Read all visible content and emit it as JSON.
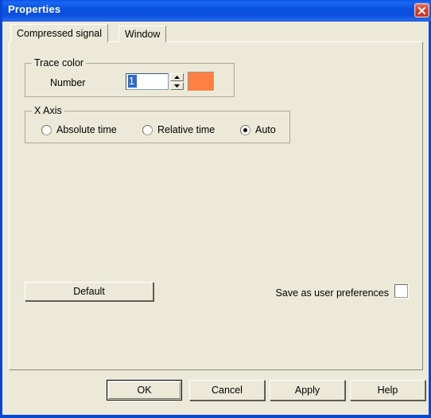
{
  "window": {
    "title": "Properties",
    "close_icon": "close-x-icon",
    "border_color": "#0a46d2",
    "titlebar_color": "#0b4fdc",
    "face_color": "#ece9d8"
  },
  "tabs": [
    {
      "label": "Compressed signal",
      "active": true
    },
    {
      "label": "Window",
      "active": false
    }
  ],
  "trace_color_group": {
    "title": "Trace color",
    "number_label": "Number",
    "number_value": "1",
    "number_placeholder": "",
    "spinner_up_icon": "triangle-up-icon",
    "spinner_down_icon": "triangle-down-icon",
    "swatch_color": "#ff8040",
    "swatch_name": "trace-color-swatch"
  },
  "x_axis_group": {
    "title": "X Axis",
    "options": [
      {
        "label": "Absolute time",
        "selected": false
      },
      {
        "label": "Relative time",
        "selected": false
      },
      {
        "label": "Auto",
        "selected": true
      }
    ]
  },
  "actions": {
    "default_label": "Default",
    "save_prefs_label": "Save as user preferences",
    "save_prefs_checked": false,
    "ok_label": "OK",
    "cancel_label": "Cancel",
    "apply_label": "Apply",
    "help_label": "Help"
  }
}
